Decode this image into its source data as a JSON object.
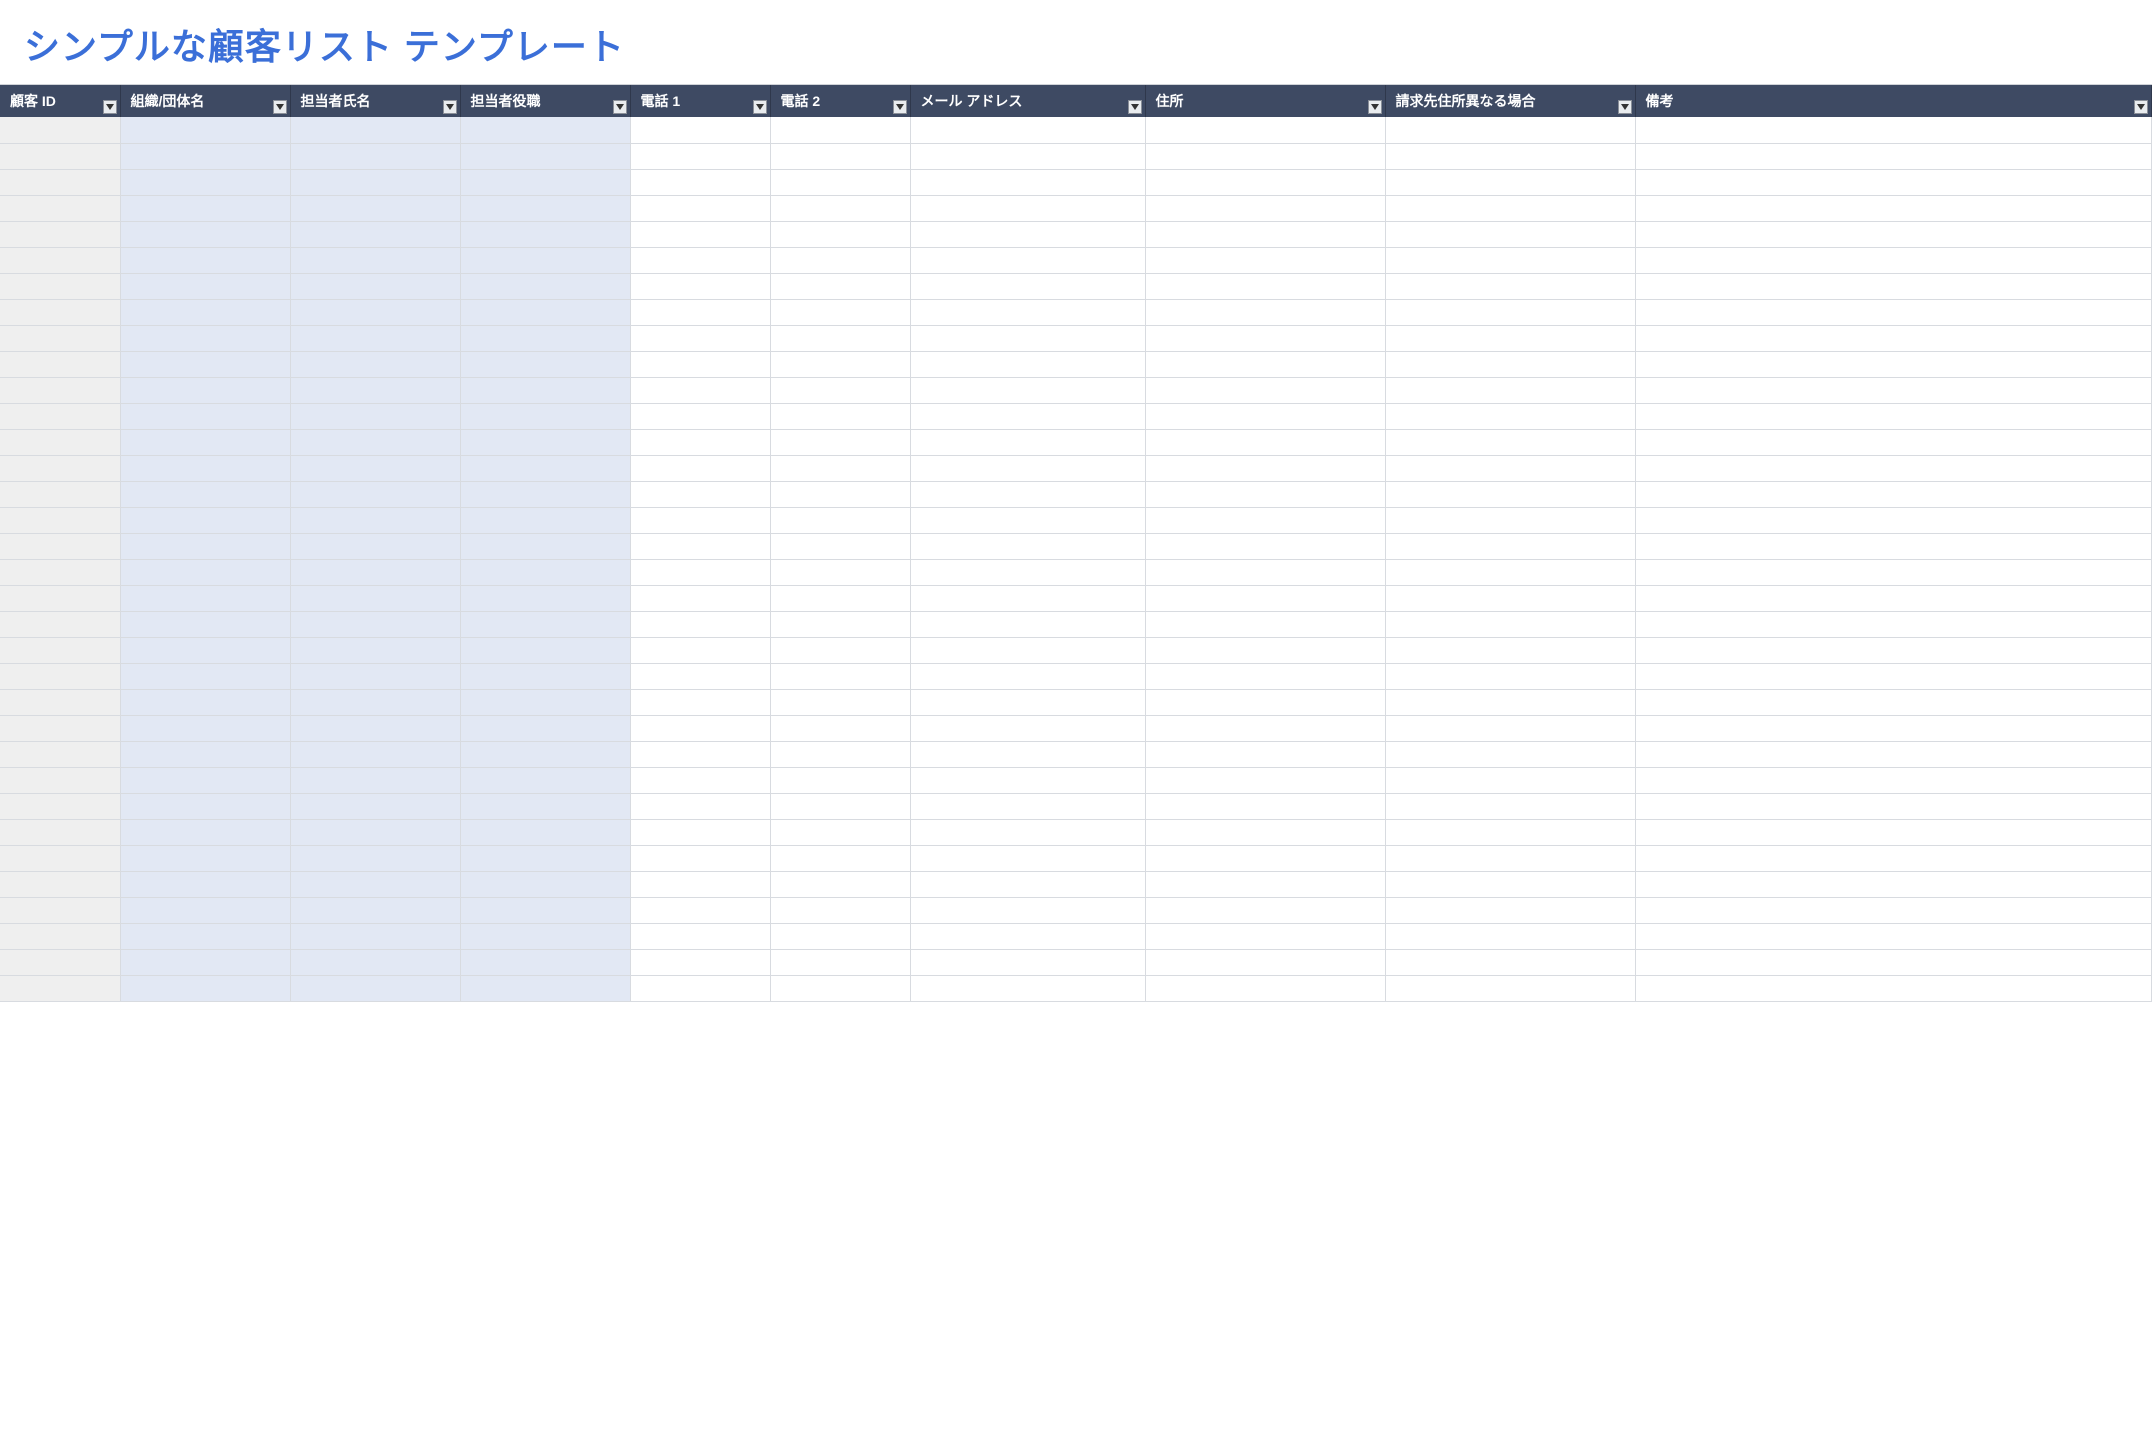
{
  "title": "シンプルな顧客リスト テンプレート",
  "columns": [
    {
      "label": "顧客 ID"
    },
    {
      "label": "組織/団体名"
    },
    {
      "label": "担当者氏名"
    },
    {
      "label": "担当者役職"
    },
    {
      "label": "電話 1"
    },
    {
      "label": "電話 2"
    },
    {
      "label": "メール アドレス"
    },
    {
      "label": "住所"
    },
    {
      "label": "請求先住所異なる場合"
    },
    {
      "label": "備考"
    }
  ],
  "row_count": 34
}
